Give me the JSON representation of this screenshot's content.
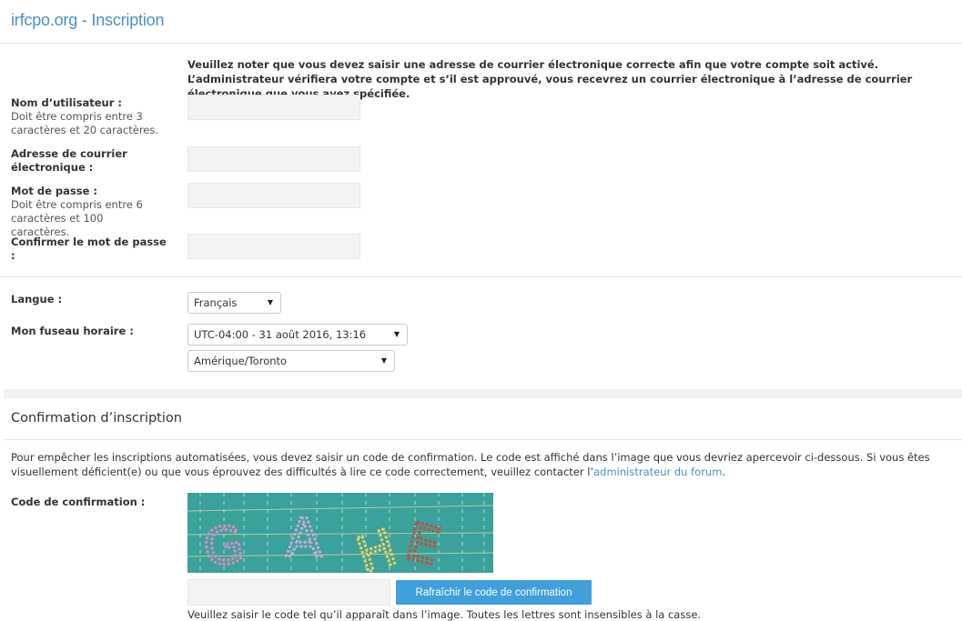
{
  "header": {
    "title": "irfcpo.org - Inscription"
  },
  "notice": "Veuillez noter que vous devez saisir une adresse de courrier électronique correcte afin que votre compte soit activé. L’administrateur vérifiera votre compte et s’il est approuvé, vous recevrez un courrier électronique à l’adresse de courrier électronique que vous avez spécifiée.",
  "fields": {
    "username": {
      "label": "Nom d’utilisateur :",
      "hint": "Doit être compris entre 3 caractères et 20 caractères.",
      "value": ""
    },
    "email": {
      "label": "Adresse de courrier électronique :",
      "value": ""
    },
    "password": {
      "label": "Mot de passe :",
      "hint": "Doit être compris entre 6 caractères et 100 caractères.",
      "value": ""
    },
    "confirm_password": {
      "label": "Confirmer le mot de passe :",
      "value": ""
    }
  },
  "language": {
    "label": "Langue :",
    "selected": "Français"
  },
  "timezone": {
    "label": "Mon fuseau horaire :",
    "offset_selected": "UTC-04:00 - 31 août 2016, 13:16",
    "zone_selected": "Amérique/Toronto"
  },
  "confirmation": {
    "title": "Confirmation d’inscription",
    "text_before_link": "Pour empêcher les inscriptions automatisées, vous devez saisir un code de confirmation. Le code est affiché dans l’image que vous devriez apercevoir ci-dessous. Si vous êtes visuellement déficient(e) ou que vous éprouvez des difficultés à lire ce code correctement, veuillez contacter l’",
    "link_text": "administrateur du forum",
    "text_after_link": ".",
    "code_label": "Code de confirmation :",
    "captcha_text": "GAHE",
    "refresh_label": "Rafraîchir le code de confirmation",
    "help": "Veuillez saisir le code tel qu’il apparaît dans l’image. Toutes les lettres sont insensibles à la casse."
  },
  "colors": {
    "link": "#4a90c4",
    "button": "#3fa0db",
    "captcha_bg": "#3aa29a"
  }
}
